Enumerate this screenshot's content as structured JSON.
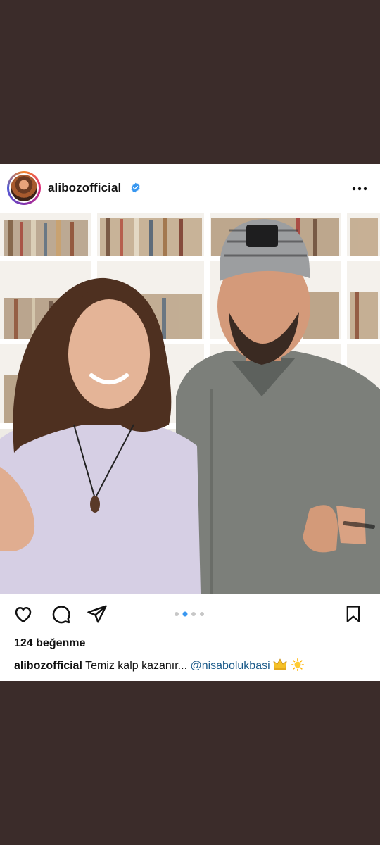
{
  "post": {
    "username": "alibozofficial",
    "likes_text": "124 beğenme",
    "caption": {
      "username": "alibozofficial",
      "text": " Temiz kalp kazanır... ",
      "mention": "@nisabolukbasi",
      "emojis": [
        "crown-emoji",
        "sun-emoji"
      ]
    },
    "carousel": {
      "count": 4,
      "active_index": 1
    },
    "image": {
      "description_icon": "photo"
    }
  },
  "colors": {
    "background": "#3b2c2a",
    "card": "#ffffff",
    "verified": "#3897f0",
    "mention": "#1c5b8a",
    "dot_active": "#3897f0",
    "dot_inactive": "#c7c7c7"
  }
}
